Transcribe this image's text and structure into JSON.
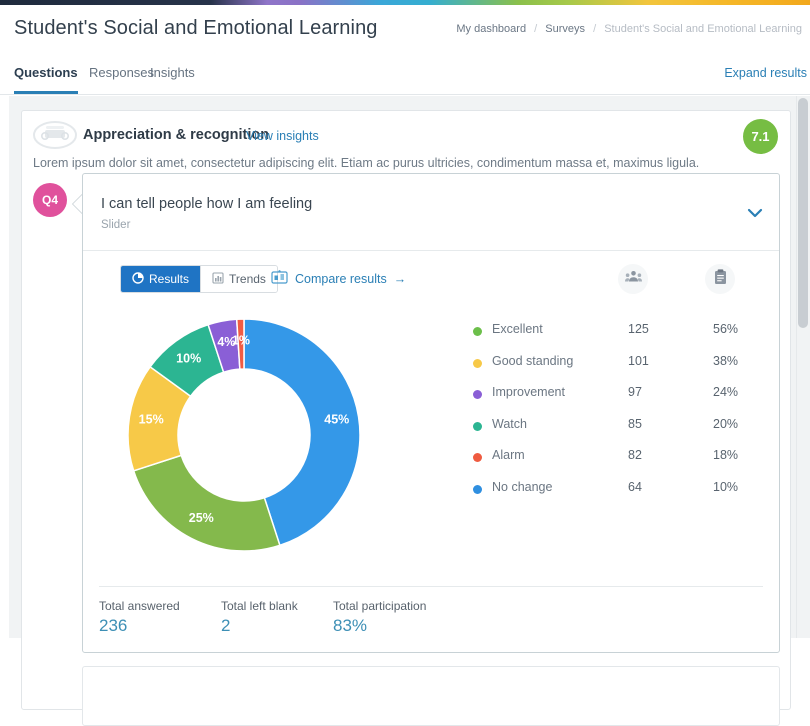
{
  "header": {
    "title": "Student's Social and Emotional Learning",
    "breadcrumb": {
      "home": "My dashboard",
      "sep1": "/",
      "section": "Surveys",
      "sep2": "/",
      "current": "Student's Social and Emotional Learning"
    }
  },
  "tabs": {
    "questions": "Questions",
    "responses": "Responses",
    "insights": "Insights",
    "expand_results": "Expand results"
  },
  "group": {
    "icon": "megaphone-icon",
    "title": "Appreciation & recognition",
    "view_insights": "View insights",
    "score": "7.1",
    "score_color": "#76bd43",
    "description": "Lorem ipsum dolor sit amet, consectetur adipiscing elit. Etiam ac purus ultricies, condimentum massa et, maximus ligula."
  },
  "question": {
    "badge": "Q4",
    "badge_color": "#e0519c",
    "title": "I can tell people how I am feeling",
    "type": "Slider",
    "collapse_icon": "chevron-down-icon"
  },
  "toolbar": {
    "results_tab": "Results",
    "results_icon": "pie-chart-icon",
    "trends_tab": "Trends",
    "trends_icon": "bar-chart-icon",
    "compare_results": "Compare results",
    "compare_icon": "compare-icon",
    "compare_arrow": "→",
    "people_button": "people-icon",
    "clipboard_button": "clipboard-icon"
  },
  "stats": [
    {
      "label": "Total answered",
      "value": "236"
    },
    {
      "label": "Total left blank",
      "value": "2"
    },
    {
      "label": "Total participation",
      "value": "83%"
    }
  ],
  "chart_data": {
    "type": "pie",
    "title": "",
    "donut": true,
    "legend_position": "right",
    "categories": [
      "Excellent",
      "Good standing",
      "Improvement",
      "Watch",
      "Alarm",
      "No change"
    ],
    "slice_order_clockwise_from_top": [
      "No change",
      "Excellent",
      "Good standing",
      "Watch",
      "Improvement",
      "Alarm"
    ],
    "slices": [
      {
        "label": "No change",
        "percent": 45,
        "display": "45%",
        "count": 64,
        "legend_percent": "10%",
        "color": "#3498e8"
      },
      {
        "label": "Excellent",
        "percent": 25,
        "display": "25%",
        "count": 125,
        "legend_percent": "56%",
        "color": "#84b94c"
      },
      {
        "label": "Good standing",
        "percent": 15,
        "display": "15%",
        "count": 101,
        "legend_percent": "38%",
        "color": "#f6c council"
      },
      {
        "label": "Watch",
        "percent": 10,
        "display": "10%",
        "count": 85,
        "legend_percent": "20%",
        "color": "#2cb592"
      },
      {
        "label": "Improvement",
        "percent": 4,
        "display": "4%",
        "count": 97,
        "legend_percent": "24%",
        "color": "#8a5fd6"
      },
      {
        "label": "Alarm",
        "percent": 1,
        "display": "1%",
        "count": 82,
        "legend_percent": "18%",
        "color": "#f05b43"
      }
    ],
    "legend": [
      {
        "label": "Excellent",
        "count": "125",
        "percent": "56%",
        "color": "#6cbf4a"
      },
      {
        "label": "Good standing",
        "count": "101",
        "percent": "38%",
        "color": "#f5c killer"
      },
      {
        "label": "Improvement",
        "count": "97",
        "percent": "24%",
        "color": "#8a5fd6"
      },
      {
        "label": "Watch",
        "count": "85",
        "percent": "20%",
        "color": "#2cb592"
      },
      {
        "label": "Alarm",
        "count": "82",
        "percent": "18%",
        "color": "#ef5b40"
      },
      {
        "label": "No change",
        "count": "64",
        "percent": "10%",
        "color": "#2f8fe0"
      }
    ]
  }
}
